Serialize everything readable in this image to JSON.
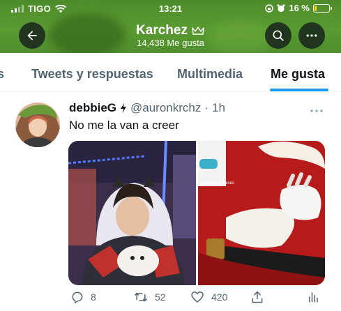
{
  "status_bar": {
    "carrier": "TIGO",
    "time": "13:21",
    "battery": "16 %",
    "battery_level": 0.16
  },
  "header": {
    "name": "Karchez",
    "likes": "14,438 Me gusta",
    "icons": [
      "arrow-left-icon",
      "search-icon",
      "more-icon",
      "crown-icon"
    ]
  },
  "tabs": [
    {
      "label": "s"
    },
    {
      "label": "Tweets y respuestas"
    },
    {
      "label": "Multimedia"
    },
    {
      "label": "Me gusta",
      "active": true
    }
  ],
  "tweet": {
    "display_name": "debbieG",
    "handle": "@auronkrchz",
    "separator": "·",
    "time": "1h",
    "text": "No me la van a creer",
    "media_overlay_text": "pablando 4 meses",
    "actions": {
      "replies": "8",
      "retweets": "52",
      "likes": "420"
    }
  },
  "colors": {
    "accent": "#1d9bf0",
    "header_green": "#5a9a31",
    "text_primary": "#0f1419",
    "text_secondary": "#536471"
  }
}
